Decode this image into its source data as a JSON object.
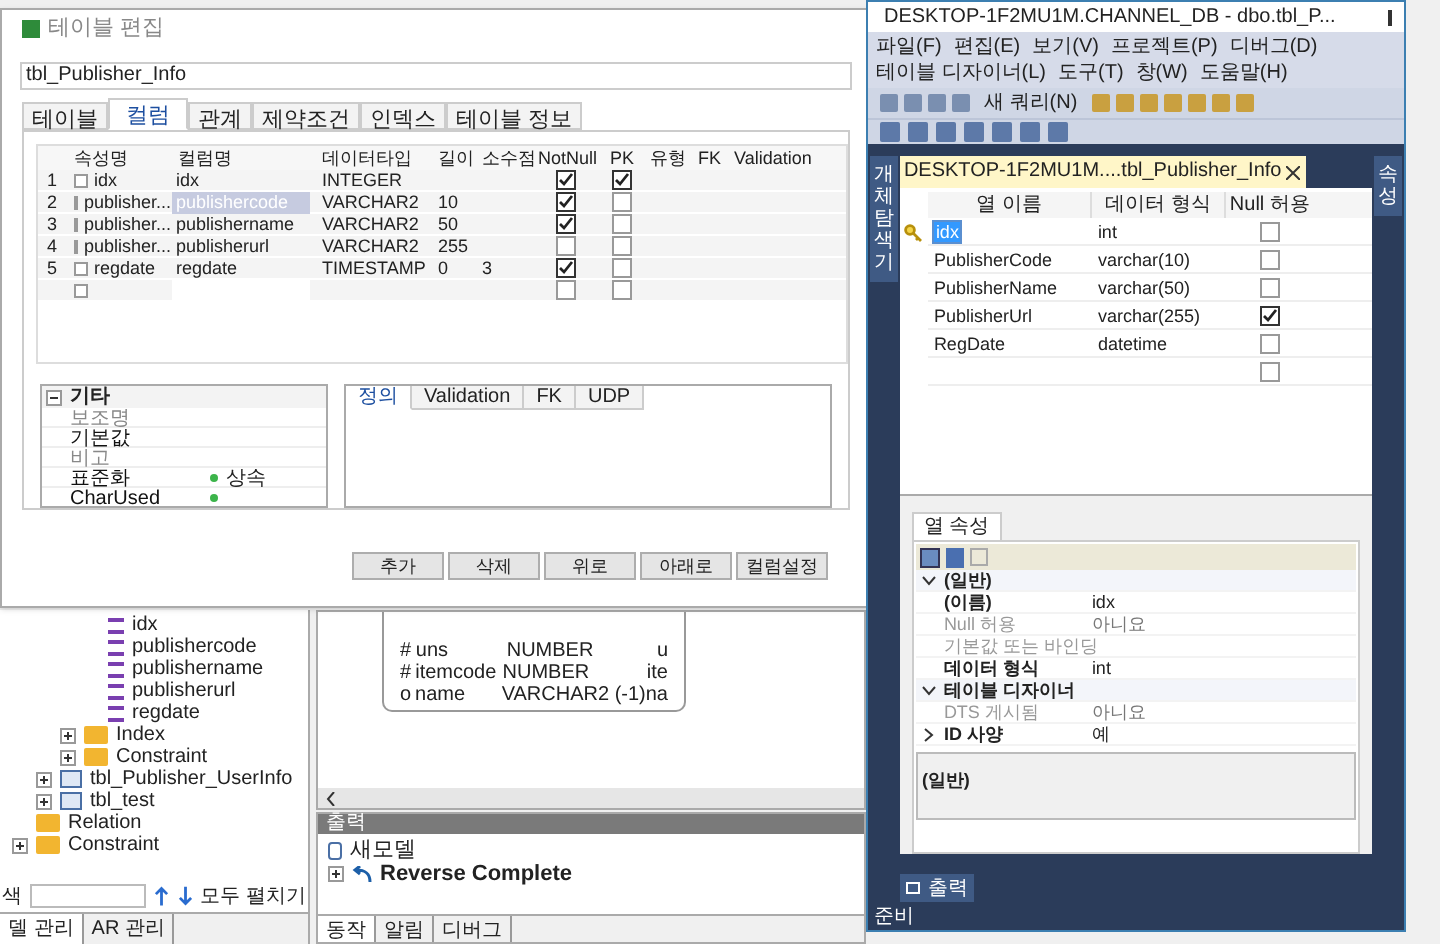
{
  "dialog": {
    "title": "테이블 편집",
    "table_name": "tbl_Publisher_Info",
    "tabs": [
      {
        "label": "테이블",
        "selected": false
      },
      {
        "label": "컬럼",
        "selected": true
      },
      {
        "label": "관계",
        "selected": false
      },
      {
        "label": "제약조건",
        "selected": false
      },
      {
        "label": "인덱스",
        "selected": false
      },
      {
        "label": "테이블 정보",
        "selected": false
      }
    ],
    "grid": {
      "columns": [
        "속성명",
        "컬럼명",
        "데이터타입",
        "길이",
        "소수점",
        "NotNull",
        "PK",
        "유형",
        "FK",
        "Validation"
      ],
      "rows": [
        {
          "number": "1",
          "attribute": "idx",
          "column": "idx",
          "type": "INTEGER",
          "not_null": true,
          "pk": true,
          "selected": false
        },
        {
          "number": "2",
          "attribute": "publisher...",
          "column": "publishercode",
          "type": "VARCHAR2",
          "length": "10",
          "not_null": true,
          "pk": false,
          "selected": true
        },
        {
          "number": "3",
          "attribute": "publisher...",
          "column": "publishername",
          "type": "VARCHAR2",
          "length": "50",
          "not_null": true,
          "pk": false,
          "selected": false
        },
        {
          "number": "4",
          "attribute": "publisher...",
          "column": "publisherurl",
          "type": "VARCHAR2",
          "length": "255",
          "not_null": false,
          "pk": false,
          "selected": false
        },
        {
          "number": "5",
          "attribute": "regdate",
          "column": "regdate",
          "type": "TIMESTAMP",
          "length": "0",
          "scale": "3",
          "not_null": true,
          "pk": false,
          "selected": false
        },
        {
          "not_null": false,
          "pk": false,
          "selected": false
        }
      ]
    },
    "properties": {
      "group": "기타",
      "expanded": true,
      "rows": [
        {
          "label": "보조명",
          "dimmed": true
        },
        {
          "label": "기본값",
          "dimmed": false
        },
        {
          "label": "비고",
          "dimmed": true
        },
        {
          "label": "표준화",
          "value": "상속",
          "dot": true,
          "dimmed": false
        },
        {
          "label": "CharUsed",
          "dot": true,
          "dimmed": false
        }
      ]
    },
    "detail_tabs": [
      {
        "label": "정의",
        "selected": true
      },
      {
        "label": "Validation",
        "selected": false
      },
      {
        "label": "FK",
        "selected": false
      },
      {
        "label": "UDP",
        "selected": false
      }
    ],
    "buttons": [
      "추가",
      "삭제",
      "위로",
      "아래로",
      "컬럼설정"
    ]
  },
  "model_tree": {
    "items": [
      {
        "kind": "folder",
        "expanded": true,
        "children": [
          {
            "kind": "table",
            "expanded": true,
            "children": [
              {
                "kind": "folder",
                "expanded": true,
                "children": [
                  {
                    "label": "idx",
                    "kind": "column"
                  },
                  {
                    "label": "publishercode",
                    "kind": "column"
                  },
                  {
                    "label": "publishername",
                    "kind": "column"
                  },
                  {
                    "label": "publisherurl",
                    "kind": "column"
                  },
                  {
                    "label": "regdate",
                    "kind": "column"
                  }
                ]
              },
              {
                "label": "Index",
                "kind": "folder",
                "expanded": false
              },
              {
                "label": "Constraint",
                "kind": "folder",
                "expanded": false
              }
            ]
          },
          {
            "label": "tbl_Publisher_UserInfo",
            "kind": "table",
            "expanded": false
          },
          {
            "label": "tbl_test",
            "kind": "table",
            "expanded": false
          }
        ]
      },
      {
        "label": "Relation",
        "kind": "folder"
      },
      {
        "label": "Constraint",
        "kind": "folder",
        "expanded": false
      }
    ],
    "search_label": "색",
    "expand_all": "모두 펼치기",
    "tabs": [
      {
        "label": "델 관리",
        "selected": true
      },
      {
        "label": "AR 관리",
        "selected": false
      }
    ]
  },
  "diagram": {
    "entity_rows": [
      {
        "marker": "#",
        "name": "uns",
        "type": "NUMBER",
        "column_4": "u"
      },
      {
        "marker": "#",
        "name": "itemcode",
        "type": "NUMBER",
        "column_4": "ite"
      },
      {
        "marker": "o",
        "name": "name",
        "type": "VARCHAR2 (-1)",
        "column_4": "na"
      }
    ]
  },
  "output": {
    "title": "출력",
    "items": [
      {
        "label": "새모델",
        "kind": "model"
      },
      {
        "label": "Reverse Complete",
        "kind": "log"
      }
    ],
    "tabs": [
      {
        "label": "동작",
        "selected": true
      },
      {
        "label": "알림",
        "selected": false
      },
      {
        "label": "디버그",
        "selected": false
      }
    ]
  },
  "ssms": {
    "title": "DESKTOP-1F2MU1M.CHANNEL_DB - dbo.tbl_P...",
    "menu": [
      "파일(F)",
      "편집(E)",
      "보기(V)",
      "프로젝트(P)",
      "디버그(D)",
      "테이블 디자이너(L)",
      "도구(T)",
      "창(W)",
      "도움말(H)"
    ],
    "new_query": "새 쿼리(N)",
    "object_explorer": "개체 탐색기",
    "document_tab": "DESKTOP-1F2MU1M....tbl_Publisher_Info",
    "properties_strip": "속성",
    "grid": {
      "columns": [
        "열 이름",
        "데이터 형식",
        "Null 허용"
      ],
      "rows": [
        {
          "name": "idx",
          "type": "int",
          "allow_null": false,
          "primary_key": true,
          "selected": true
        },
        {
          "name": "PublisherCode",
          "type": "varchar(10)",
          "allow_null": false,
          "primary_key": false,
          "selected": false
        },
        {
          "name": "PublisherName",
          "type": "varchar(50)",
          "allow_null": false,
          "primary_key": false,
          "selected": false
        },
        {
          "name": "PublisherUrl",
          "type": "varchar(255)",
          "allow_null": true,
          "primary_key": false,
          "selected": false
        },
        {
          "name": "RegDate",
          "type": "datetime",
          "allow_null": false,
          "primary_key": false,
          "selected": false
        },
        {
          "allow_null": false,
          "primary_key": false,
          "selected": false
        }
      ]
    },
    "column_properties": {
      "tab": "열 속성",
      "rows": [
        {
          "kind": "category",
          "label": "(일반)"
        },
        {
          "kind": "property",
          "label": "(이름)",
          "value": "idx",
          "dimmed": false
        },
        {
          "kind": "property",
          "label": "Null 허용",
          "value": "아니요",
          "dimmed": true
        },
        {
          "kind": "property",
          "label": "기본값 또는 바인딩",
          "dimmed": true
        },
        {
          "kind": "property",
          "label": "데이터 형식",
          "value": "int",
          "dimmed": false
        },
        {
          "kind": "category",
          "label": "테이블 디자이너"
        },
        {
          "kind": "property",
          "label": "DTS 게시됨",
          "value": "아니요",
          "dimmed": true
        },
        {
          "kind": "expandable",
          "label": "ID 사양",
          "value": "예",
          "dimmed": false
        }
      ],
      "description": "(일반)"
    },
    "output_tab": "출력",
    "status": "준비"
  }
}
